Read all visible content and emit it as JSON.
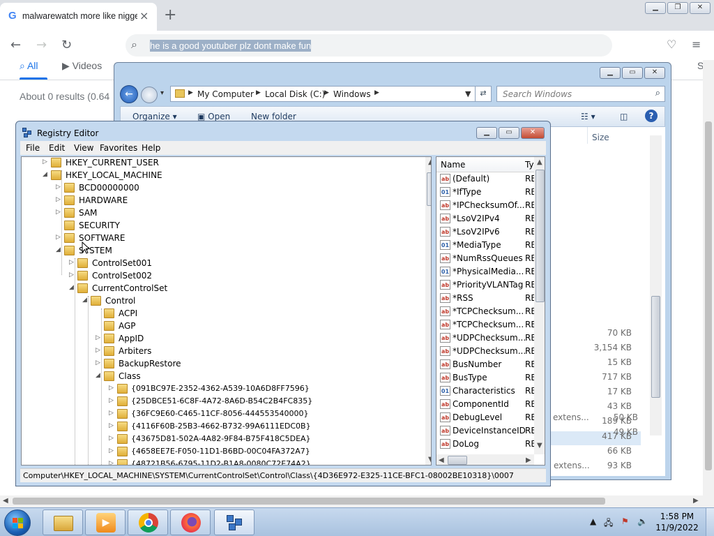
{
  "browser": {
    "tab_title": "malwarewatch more like nigger",
    "tab_close": "×",
    "new_tab": "+",
    "omnibox_text": "he is a good youtuber plz dont make fun",
    "google_tabs": [
      "All",
      "Videos"
    ],
    "results_count": "About 0 results (0.64",
    "right_edge_letter": "S"
  },
  "explorer": {
    "breadcrumbs": [
      "My Computer",
      "Local Disk (C:)",
      "Windows"
    ],
    "search_placeholder": "Search Windows",
    "commands": [
      "Organize ▾",
      "Open",
      "New folder"
    ],
    "column_size": "Size",
    "sizes": [
      "70 KB",
      "3,154 KB",
      "15 KB",
      "717 KB",
      "17 KB",
      "43 KB",
      "189 KB",
      "417 KB",
      "66 KB",
      "93 KB",
      "50 KB",
      "49 KB"
    ],
    "ext_rows": [
      "extens...",
      "extens..."
    ]
  },
  "regedit": {
    "title": "Registry Editor",
    "menu": [
      "File",
      "Edit",
      "View",
      "Favorites",
      "Help"
    ],
    "tree": [
      {
        "label": "HKEY_CURRENT_USER"
      },
      {
        "label": "HKEY_LOCAL_MACHINE"
      },
      {
        "label": "BCD00000000"
      },
      {
        "label": "HARDWARE"
      },
      {
        "label": "SAM"
      },
      {
        "label": "SECURITY"
      },
      {
        "label": "SOFTWARE"
      },
      {
        "label": "SYSTEM"
      },
      {
        "label": "ControlSet001"
      },
      {
        "label": "ControlSet002"
      },
      {
        "label": "CurrentControlSet"
      },
      {
        "label": "Control"
      },
      {
        "label": "ACPI"
      },
      {
        "label": "AGP"
      },
      {
        "label": "AppID"
      },
      {
        "label": "Arbiters"
      },
      {
        "label": "BackupRestore"
      },
      {
        "label": "Class"
      },
      {
        "label": "{091BC97E-2352-4362-A539-10A6D8FF7596}"
      },
      {
        "label": "{25DBCE51-6C8F-4A72-8A6D-B54C2B4FC835}"
      },
      {
        "label": "{36FC9E60-C465-11CF-8056-444553540000}"
      },
      {
        "label": "{4116F60B-25B3-4662-B732-99A6111EDC0B}"
      },
      {
        "label": "{43675D81-502A-4A82-9F84-B75F418C5DEA}"
      },
      {
        "label": "{4658EE7E-F050-11D1-B6BD-00C04FA372A7}"
      },
      {
        "label": "{48721B56-6795-11D2-B1A8-0080C72E74A2}"
      }
    ],
    "list_headers": {
      "name": "Name",
      "type": "Ty"
    },
    "values": [
      {
        "name": "(Default)",
        "type": "RE",
        "kind": "sz"
      },
      {
        "name": "*IfType",
        "type": "RE",
        "kind": "bin"
      },
      {
        "name": "*IPChecksumOf...",
        "type": "RE",
        "kind": "sz"
      },
      {
        "name": "*LsoV2IPv4",
        "type": "RE",
        "kind": "sz"
      },
      {
        "name": "*LsoV2IPv6",
        "type": "RE",
        "kind": "sz"
      },
      {
        "name": "*MediaType",
        "type": "RE",
        "kind": "bin"
      },
      {
        "name": "*NumRssQueues",
        "type": "RE",
        "kind": "sz"
      },
      {
        "name": "*PhysicalMedia...",
        "type": "RE",
        "kind": "bin"
      },
      {
        "name": "*PriorityVLANTag",
        "type": "RE",
        "kind": "sz"
      },
      {
        "name": "*RSS",
        "type": "RE",
        "kind": "sz"
      },
      {
        "name": "*TCPChecksum...",
        "type": "RE",
        "kind": "sz"
      },
      {
        "name": "*TCPChecksum...",
        "type": "RE",
        "kind": "sz"
      },
      {
        "name": "*UDPChecksum...",
        "type": "RE",
        "kind": "sz"
      },
      {
        "name": "*UDPChecksum...",
        "type": "RE",
        "kind": "sz"
      },
      {
        "name": "BusNumber",
        "type": "RE",
        "kind": "sz"
      },
      {
        "name": "BusType",
        "type": "RE",
        "kind": "sz"
      },
      {
        "name": "Characteristics",
        "type": "RE",
        "kind": "bin"
      },
      {
        "name": "ComponentId",
        "type": "RE",
        "kind": "sz"
      },
      {
        "name": "DebugLevel",
        "type": "RE",
        "kind": "sz"
      },
      {
        "name": "DeviceInstanceID",
        "type": "RE",
        "kind": "sz"
      },
      {
        "name": "DoLog",
        "type": "RE",
        "kind": "sz"
      }
    ],
    "status_path": "Computer\\HKEY_LOCAL_MACHINE\\SYSTEM\\CurrentControlSet\\Control\\Class\\{4D36E972-E325-11CE-BFC1-08002BE10318}\\0007"
  },
  "taskbar": {
    "time": "1:58 PM",
    "date": "11/9/2022"
  },
  "colors": {
    "chrome_tabbar": "#dee1e6",
    "google_blue": "#1a73e8",
    "win7_frame": "#c4d9ef",
    "close_red": "#c44b32"
  }
}
